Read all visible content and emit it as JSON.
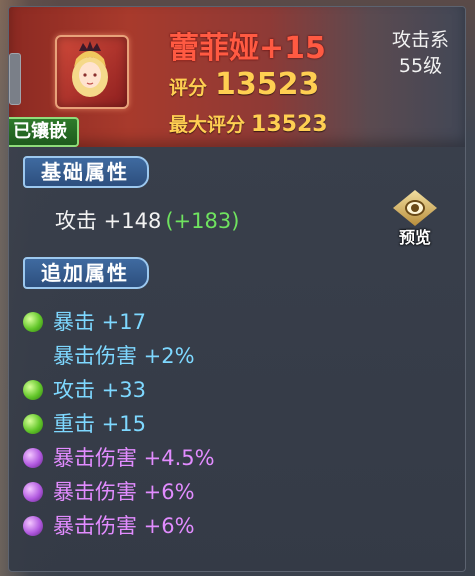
{
  "item": {
    "name": "蕾菲娅+15",
    "score_label": "评分",
    "score": "13523",
    "max_score_label": "最大评分",
    "max_score": "13523",
    "type": "攻击系",
    "level": "55级",
    "status_tag": "已镶嵌"
  },
  "sections": {
    "base_title": "基础属性",
    "extra_title": "追加属性"
  },
  "base_attribute": {
    "label": "攻击 +148",
    "bonus": "(+183)"
  },
  "preview": {
    "label": "预览"
  },
  "extra_attributes": [
    {
      "gem": "green",
      "text": "暴击 +17"
    },
    {
      "gem": "",
      "text": "暴击伤害 +2%"
    },
    {
      "gem": "green",
      "text": "攻击 +33"
    },
    {
      "gem": "green",
      "text": "重击 +15"
    },
    {
      "gem": "purple",
      "text": "暴击伤害 +4.5%"
    },
    {
      "gem": "purple",
      "text": "暴击伤害 +6%"
    },
    {
      "gem": "purple",
      "text": "暴击伤害 +6%"
    }
  ],
  "colors": {
    "name": "#ff5a42",
    "score": "#ffcf52",
    "bonus": "#6fe35f",
    "blue_attr": "#7ed8ff",
    "purple_attr": "#e28cff"
  }
}
